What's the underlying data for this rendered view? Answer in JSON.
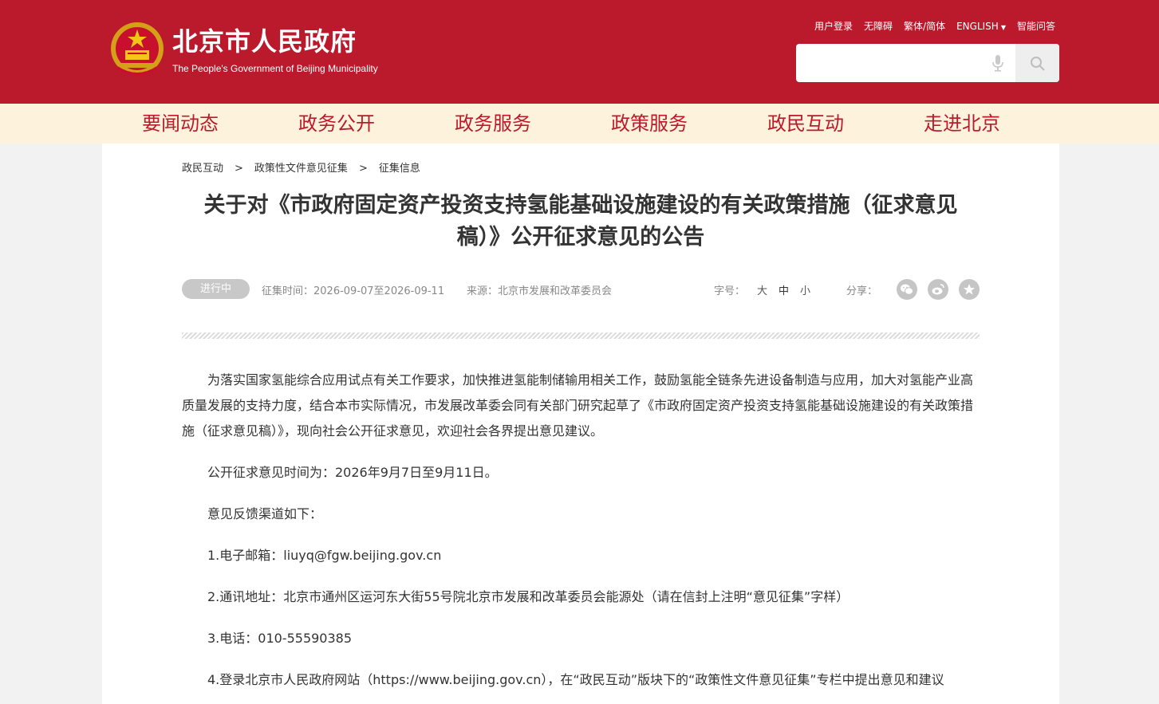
{
  "header": {
    "site_title": "北京市人民政府",
    "site_subtitle": "The People's Government of Beijing Municipality",
    "emblem_icon": "national-emblem-icon",
    "top_links": [
      "用户登录",
      "无障碍",
      "繁体/简体",
      "ENGLISH",
      "智能问答"
    ],
    "search": {
      "placeholder": "",
      "value": ""
    }
  },
  "nav": {
    "items": [
      "要闻动态",
      "政务公开",
      "政务服务",
      "政策服务",
      "政民互动",
      "走进北京"
    ]
  },
  "breadcrumb": [
    "政民互动",
    "政策性文件意见征集",
    "征集信息"
  ],
  "breadcrumb_separator": ">",
  "article": {
    "title_line1": "关于对《市政府固定资产投资支持氢能基础设施建设的有关政策措施（征求意见",
    "title_line2": "稿）》公开征求意见的公告",
    "status": "进行中",
    "time": "征集时间：2026-09-07至2026-09-11",
    "source": "来源：北京市发展和改革委员会",
    "font_label": "字号：",
    "font_sizes": [
      "大",
      "中",
      "小"
    ],
    "share_label": "分享：",
    "share_icons": [
      "wechat-icon",
      "weibo-icon",
      "favorite-star-icon"
    ],
    "paragraphs": [
      "为落实国家氢能综合应用试点有关工作要求，加快推进氢能制储输用相关工作，鼓励氢能全链条先进设备制造与应用，加大对氢能产业高质量发展的支持力度，结合本市实际情况，市发展改革委会同有关部门研究起草了《市政府固定资产投资支持氢能基础设施建设的有关政策措施（征求意见稿）》，现向社会公开征求意见，欢迎社会各界提出意见建议。",
      "公开征求意见时间为：2026年9月7日至9月11日。",
      "意见反馈渠道如下：",
      "1.电子邮箱：liuyq@fgw.beijing.gov.cn",
      "2.通讯地址：北京市通州区运河东大街55号院北京市发展和改革委员会能源处（请在信封上注明“意见征集”字样）",
      "3.电话：010-55590385",
      "4.登录北京市人民政府网站（https://www.beijing.gov.cn），在“政民互动”版块下的“政策性文件意见征集”专栏中提出意见和建议"
    ]
  },
  "colors": {
    "brand_red": "#bb1a2c",
    "nav_bg": "#fdf3dc",
    "page_bg": "#f2f2f2",
    "badge_gray": "#c8c8c8"
  }
}
